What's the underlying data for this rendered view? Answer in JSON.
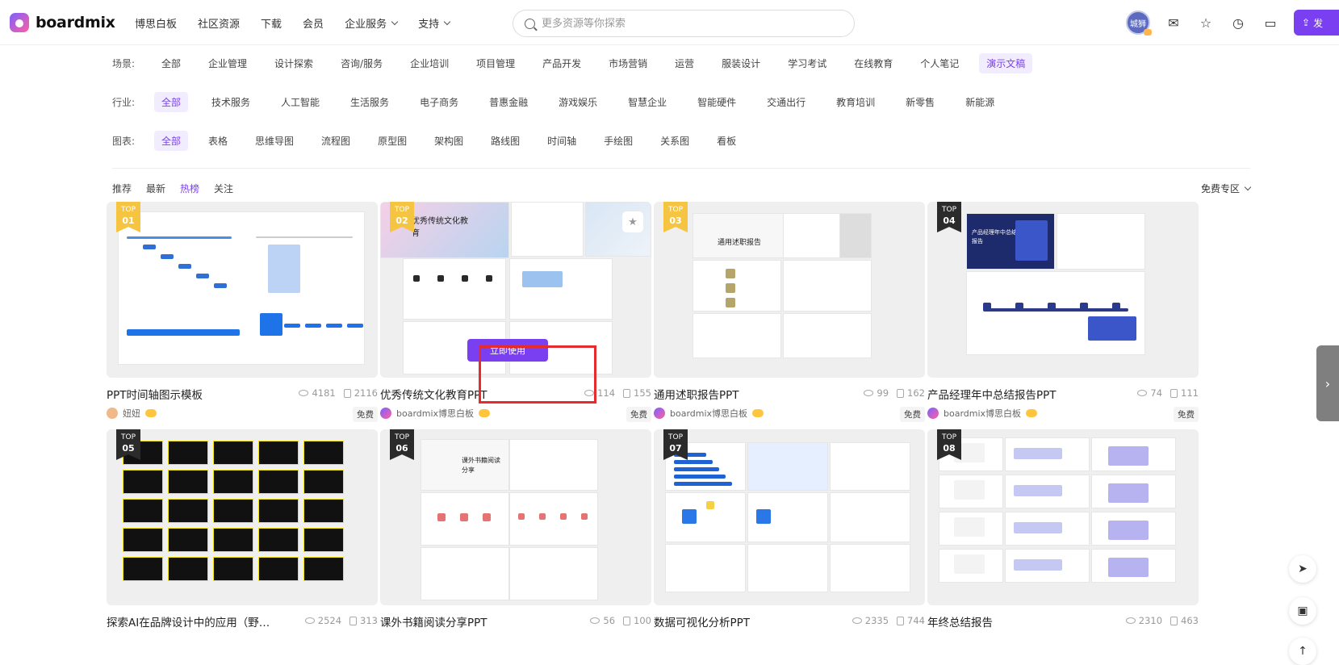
{
  "header": {
    "logo_text": "boardmix",
    "nav": [
      {
        "label": "博思白板",
        "dropdown": false
      },
      {
        "label": "社区资源",
        "dropdown": false
      },
      {
        "label": "下载",
        "dropdown": false
      },
      {
        "label": "会员",
        "dropdown": false
      },
      {
        "label": "企业服务",
        "dropdown": true
      },
      {
        "label": "支持",
        "dropdown": true
      }
    ],
    "search_placeholder": "更多资源等你探索",
    "avatar_text": "城狮",
    "publish_label": "发"
  },
  "filters": {
    "scene": {
      "label": "场景:",
      "items": [
        "全部",
        "企业管理",
        "设计探索",
        "咨询/服务",
        "企业培训",
        "项目管理",
        "产品开发",
        "市场营销",
        "运营",
        "服装设计",
        "学习考试",
        "在线教育",
        "个人笔记",
        "演示文稿"
      ],
      "active": "演示文稿"
    },
    "industry": {
      "label": "行业:",
      "items": [
        "全部",
        "技术服务",
        "人工智能",
        "生活服务",
        "电子商务",
        "普惠金融",
        "游戏娱乐",
        "智慧企业",
        "智能硬件",
        "交通出行",
        "教育培训",
        "新零售",
        "新能源"
      ],
      "active": "全部"
    },
    "chart": {
      "label": "图表:",
      "items": [
        "全部",
        "表格",
        "思维导图",
        "流程图",
        "原型图",
        "架构图",
        "路线图",
        "时间轴",
        "手绘图",
        "关系图",
        "看板"
      ],
      "active": "全部"
    }
  },
  "sort_tabs": {
    "items": [
      "推荐",
      "最新",
      "热榜",
      "关注"
    ],
    "active": "热榜"
  },
  "free_zone_label": "免费专区",
  "rank_top_label": "TOP",
  "use_button_label": "立即使用",
  "cards": [
    {
      "rank": "01",
      "title": "PPT时间轴图示模板",
      "views": "4181",
      "copies": "2116",
      "author": "妞妞",
      "badge": "免费"
    },
    {
      "rank": "02",
      "title": "优秀传统文化教育PPT",
      "views": "114",
      "copies": "155",
      "author": "boardmix博思白板",
      "badge": "免费"
    },
    {
      "rank": "03",
      "title": "通用述职报告PPT",
      "views": "99",
      "copies": "162",
      "author": "boardmix博思白板",
      "badge": "免费"
    },
    {
      "rank": "04",
      "title": "产品经理年中总结报告PPT",
      "views": "74",
      "copies": "111",
      "author": "boardmix博思白板",
      "badge": "免费"
    },
    {
      "rank": "05",
      "title": "探索AI在品牌设计中的应用（野…",
      "views": "2524",
      "copies": "313"
    },
    {
      "rank": "06",
      "title": "课外书籍阅读分享PPT",
      "views": "56",
      "copies": "100"
    },
    {
      "rank": "07",
      "title": "数据可视化分析PPT",
      "views": "2335",
      "copies": "744"
    },
    {
      "rank": "08",
      "title": "年终总结报告",
      "views": "2310",
      "copies": "463"
    }
  ],
  "thumb_text": {
    "t2_title": "优秀传统文化教育",
    "t3_title": "通用述职报告",
    "t4_title": "产品经理年中总结报告",
    "t6_title": "课外书籍阅读分享"
  }
}
